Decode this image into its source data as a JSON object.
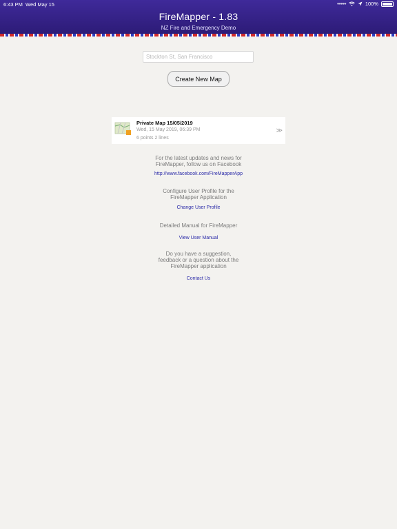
{
  "status_bar": {
    "time": "6:43 PM",
    "date": "Wed May 15",
    "battery": "100%"
  },
  "header": {
    "title": "FireMapper - 1.83",
    "subtitle": "NZ Fire and Emergency Demo"
  },
  "search": {
    "placeholder": "Stockton St, San Francisco"
  },
  "create_button": "Create New Map",
  "map_list": [
    {
      "title": "Private Map 15/05/2019",
      "date": "Wed, 15 May 2019, 06:39 PM",
      "stats": "6 points  2 lines"
    }
  ],
  "facebook": {
    "text_line1": "For the latest updates and news for",
    "text_line2": "FireMapper, follow us on Facebook",
    "link": "http://www.facebook.com/FireMapperApp"
  },
  "profile": {
    "text_line1": "Configure User Profile for the",
    "text_line2": "FireMapper Application",
    "link": "Change User Profile"
  },
  "manual": {
    "text": "Detailed Manual for FireMapper",
    "link": "View User Manual"
  },
  "contact": {
    "text_line1": "Do you have a suggestion,",
    "text_line2": "feedback or a question about the",
    "text_line3": "FireMapper application",
    "link": "Contact Us"
  },
  "icons": {
    "wifi": "wifi-icon",
    "location": "location-arrow-icon",
    "battery": "battery-icon",
    "map_thumbnail": "map-thumbnail-icon",
    "chevron": "chevron-right-icon"
  }
}
